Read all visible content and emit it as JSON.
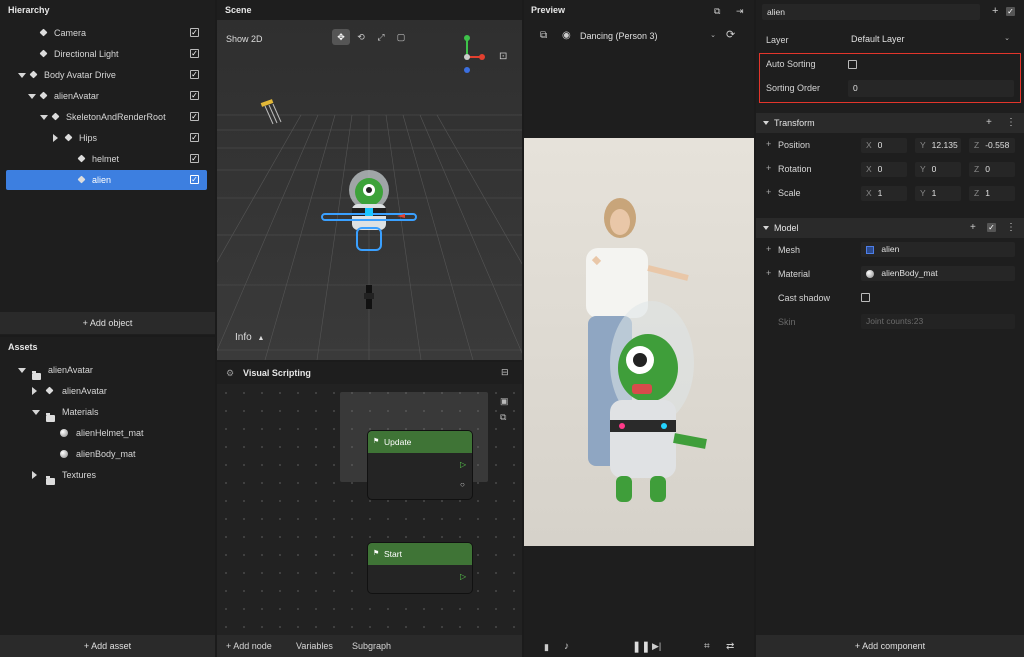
{
  "hierarchy": {
    "title": "Hierarchy",
    "items": [
      {
        "label": "Camera",
        "depth": 2,
        "expand": "none",
        "checked": true
      },
      {
        "label": "Directional Light",
        "depth": 2,
        "expand": "none",
        "checked": true
      },
      {
        "label": "Body Avatar Drive",
        "depth": 1,
        "expand": "down",
        "checked": true
      },
      {
        "label": "alienAvatar",
        "depth": 2,
        "expand": "down",
        "checked": true
      },
      {
        "label": "SkeletonAndRenderRoot",
        "depth": 3,
        "expand": "down",
        "checked": true
      },
      {
        "label": "Hips",
        "depth": 4,
        "expand": "right",
        "checked": true
      },
      {
        "label": "helmet",
        "depth": 5,
        "expand": "none",
        "checked": true
      },
      {
        "label": "alien",
        "depth": 5,
        "expand": "none",
        "checked": true,
        "selected": true
      }
    ],
    "add_label": "+ Add object"
  },
  "assets": {
    "title": "Assets",
    "items": [
      {
        "label": "alienAvatar",
        "depth": 1,
        "expand": "down",
        "kind": "folder"
      },
      {
        "label": "alienAvatar",
        "depth": 2,
        "expand": "right",
        "kind": "cube"
      },
      {
        "label": "Materials",
        "depth": 2,
        "expand": "down",
        "kind": "folder"
      },
      {
        "label": "alienHelmet_mat",
        "depth": 3,
        "expand": "none",
        "kind": "ball"
      },
      {
        "label": "alienBody_mat",
        "depth": 3,
        "expand": "none",
        "kind": "ball"
      },
      {
        "label": "Textures",
        "depth": 2,
        "expand": "right",
        "kind": "folder"
      }
    ],
    "add_label": "+ Add asset"
  },
  "scene": {
    "title": "Scene",
    "show2d": "Show 2D",
    "info": "Info",
    "tools": [
      "move-icon",
      "rotate-icon",
      "scale-icon",
      "rect-icon"
    ]
  },
  "visual_scripting": {
    "title": "Visual Scripting",
    "nodes": [
      {
        "label": "Update"
      },
      {
        "label": "Start"
      }
    ],
    "bottom": {
      "add_node": "+ Add node",
      "variables": "Variables",
      "subgraph": "Subgraph"
    }
  },
  "preview": {
    "title": "Preview",
    "dropdown": "Dancing (Person 3)"
  },
  "inspector": {
    "name": "alien",
    "layer_label": "Layer",
    "layer_value": "Default Layer",
    "auto_sorting_label": "Auto Sorting",
    "sorting_order_label": "Sorting Order",
    "sorting_order_value": "0",
    "highlight_color": "#e2352b",
    "transform": {
      "title": "Transform",
      "position": {
        "label": "Position",
        "x": "0",
        "y": "12.135",
        "z": "-0.558"
      },
      "rotation": {
        "label": "Rotation",
        "x": "0",
        "y": "0",
        "z": "0"
      },
      "scale": {
        "label": "Scale",
        "x": "1",
        "y": "1",
        "z": "1"
      }
    },
    "model": {
      "title": "Model",
      "mesh_label": "Mesh",
      "mesh_value": "alien",
      "material_label": "Material",
      "material_value": "alienBody_mat",
      "cast_shadow_label": "Cast shadow",
      "skin_label": "Skin",
      "skin_value": "Joint counts:23"
    },
    "add_component": "+ Add component"
  }
}
